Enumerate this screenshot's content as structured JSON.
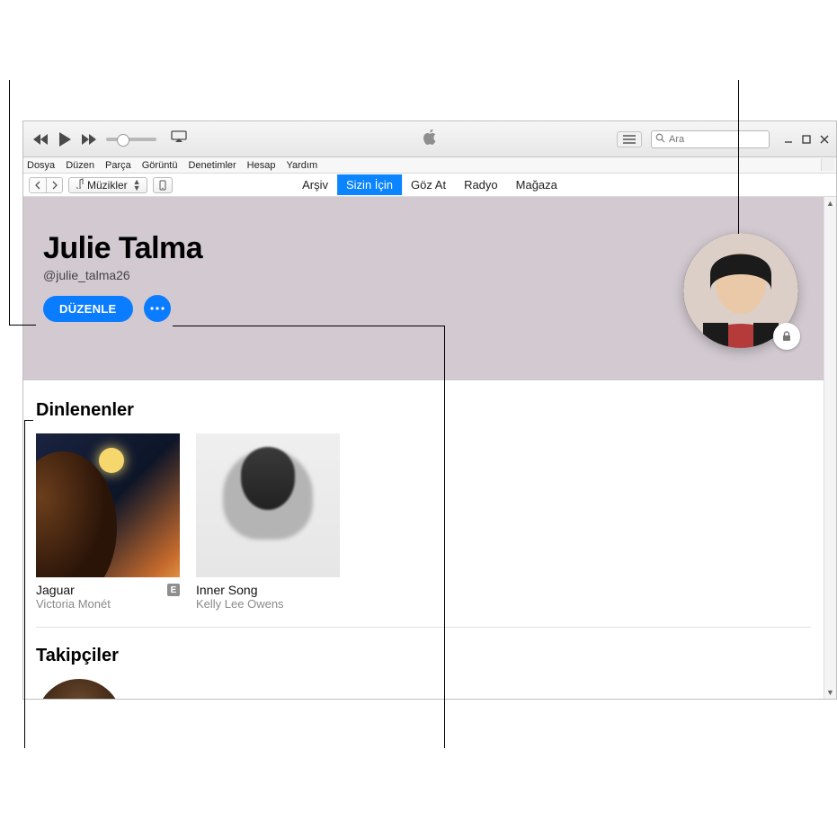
{
  "menubar": {
    "items": [
      "Dosya",
      "Düzen",
      "Parça",
      "Görüntü",
      "Denetimler",
      "Hesap",
      "Yardım"
    ]
  },
  "toolbar": {
    "search_placeholder": "Ara",
    "library_label": "Müzikler"
  },
  "tabs": {
    "items": [
      {
        "label": "Arşiv",
        "active": false
      },
      {
        "label": "Sizin İçin",
        "active": true
      },
      {
        "label": "Göz At",
        "active": false
      },
      {
        "label": "Radyo",
        "active": false
      },
      {
        "label": "Mağaza",
        "active": false
      }
    ]
  },
  "profile": {
    "name": "Julie Talma",
    "handle": "@julie_talma26",
    "edit_label": "DÜZENLE"
  },
  "sections": {
    "listening": {
      "title": "Dinlenenler",
      "albums": [
        {
          "title": "Jaguar",
          "artist": "Victoria Monét",
          "explicit": true
        },
        {
          "title": "Inner Song",
          "artist": "Kelly Lee Owens",
          "explicit": false
        }
      ]
    },
    "followers": {
      "title": "Takipçiler"
    }
  },
  "explicit_badge": "E"
}
